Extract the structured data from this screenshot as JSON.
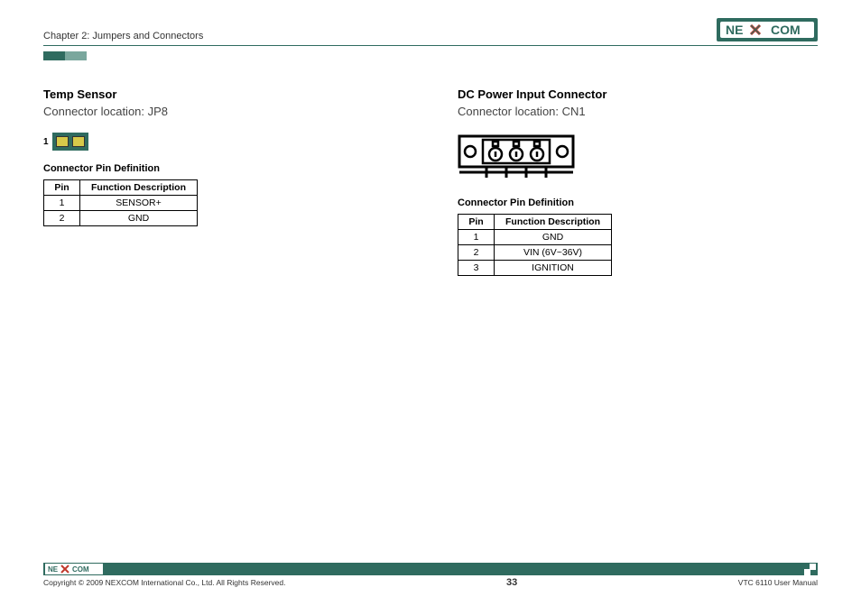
{
  "header": {
    "chapter": "Chapter 2: Jumpers and Connectors",
    "logo_text_ne": "NE",
    "logo_text_com": "COM"
  },
  "left": {
    "title": "Temp Sensor",
    "location": "Connector location: JP8",
    "pin1_label": "1",
    "pin_def_title": "Connector Pin Definition",
    "table": {
      "headers": {
        "pin": "Pin",
        "fn": "Function Description"
      },
      "rows": [
        {
          "pin": "1",
          "fn": "SENSOR+"
        },
        {
          "pin": "2",
          "fn": "GND"
        }
      ]
    }
  },
  "right": {
    "title": "DC Power Input Connector",
    "location": "Connector location: CN1",
    "pin_def_title": "Connector Pin Definition",
    "table": {
      "headers": {
        "pin": "Pin",
        "fn": "Function Description"
      },
      "rows": [
        {
          "pin": "1",
          "fn": "GND"
        },
        {
          "pin": "2",
          "fn": "VIN (6V~36V)"
        },
        {
          "pin": "3",
          "fn": "IGNITION"
        }
      ]
    }
  },
  "footer": {
    "copyright": "Copyright © 2009 NEXCOM International Co., Ltd. All Rights Reserved.",
    "page": "33",
    "manual": "VTC 6110 User Manual"
  }
}
